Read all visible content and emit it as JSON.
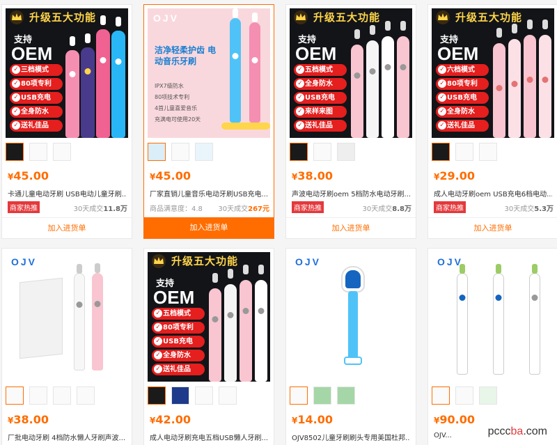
{
  "products": [
    {
      "price": "45.00",
      "title": "卡通儿童电动牙刷 USB电动儿童牙刷...",
      "tag": "商家热推",
      "sales_prefix": "30天成交",
      "sales": "11.8万",
      "add_label": "加入进货单",
      "poster": {
        "banner": "升级五大功能",
        "support": "支持",
        "oem": "OEM",
        "features": [
          "三档模式",
          "80项专利",
          "USB充电",
          "全身防水",
          "送礼佳品"
        ]
      }
    },
    {
      "price": "45.00",
      "title": "厂家直销儿童音乐电动牙刷USB充电...",
      "rating_label": "商品满意度：4.8",
      "sales_prefix": "30天成交",
      "sales": "267元",
      "add_label": "加入进货单",
      "poster": {
        "logo": "OJV",
        "headline": "洁净轻柔护齿 电动音乐牙刷",
        "bullets": [
          "IPX7级防水",
          "80项技术专利",
          "4首儿童喜爱音乐",
          "充满电可使用20天"
        ]
      }
    },
    {
      "price": "38.00",
      "title": "声波电动牙刷oem 5档防水电动牙刷...",
      "tag": "商家热推",
      "sales_prefix": "30天成交",
      "sales": "8.8万",
      "add_label": "加入进货单",
      "poster": {
        "banner": "升级五大功能",
        "support": "支持",
        "oem": "OEM",
        "features": [
          "五档模式",
          "全身防水",
          "USB充电",
          "来样来图",
          "送礼佳品"
        ]
      }
    },
    {
      "price": "29.00",
      "title": "成人电动牙刷oem USB充电6档电动...",
      "tag": "商家热推",
      "sales_prefix": "30天成交",
      "sales": "5.3万",
      "add_label": "加入进货单",
      "poster": {
        "banner": "升级五大功能",
        "support": "支持",
        "oem": "OEM",
        "features": [
          "六档模式",
          "80项专利",
          "USB充电",
          "全身防水",
          "送礼佳品"
        ]
      }
    },
    {
      "price": "38.00",
      "title": "厂批电动牙刷 4档防水懒人牙刷声波...",
      "poster": {
        "logo": "OJV"
      }
    },
    {
      "price": "42.00",
      "title": "成人电动牙刷充电五档USB懒人牙刷...",
      "poster": {
        "banner": "升级五大功能",
        "support": "支持",
        "oem": "OEM",
        "features": [
          "五档模式",
          "80项专利",
          "USB充电",
          "全身防水",
          "送礼佳品"
        ]
      }
    },
    {
      "price": "14.00",
      "title": "OJV8502儿童牙刷刷头专用美国杜邦...",
      "poster": {
        "logo": "OJV"
      }
    },
    {
      "price": "90.00",
      "title": "OJV...",
      "poster": {
        "logo": "OJV"
      }
    }
  ],
  "currency": "¥",
  "watermark": {
    "name": "pccc",
    "sep": "ba",
    "tld": ".com"
  },
  "colors": {
    "accent": "#ff6d00",
    "tag": "#e4393c",
    "feature": "#e51e1e",
    "banner_text": "#ffd54a"
  }
}
